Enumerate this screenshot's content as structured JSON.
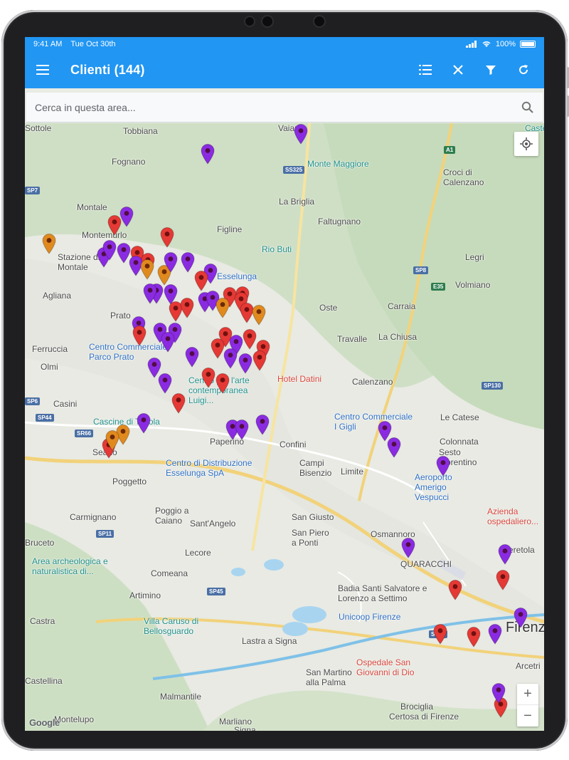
{
  "status": {
    "time": "9:41 AM",
    "date": "Tue Oct 30th",
    "battery": "100%"
  },
  "appbar": {
    "title": "Clienti (144)",
    "actions": [
      "list-icon",
      "close-icon",
      "filter-icon",
      "refresh-icon"
    ]
  },
  "search": {
    "placeholder": "Cerca in questa area..."
  },
  "colors": {
    "accent": "#2196f3",
    "pin_red": "#e53935",
    "pin_purple": "#8a2be2",
    "pin_orange": "#e08a1e"
  },
  "places": [
    {
      "t": "Tobbiana",
      "c": ""
    },
    {
      "t": "Fognano",
      "c": ""
    },
    {
      "t": "Montale",
      "c": ""
    },
    {
      "t": "Montemurlo",
      "c": ""
    },
    {
      "t": "Stazione di Montale",
      "c": ""
    },
    {
      "t": "Agliana",
      "c": ""
    },
    {
      "t": "Figline",
      "c": ""
    },
    {
      "t": "Faltugnano",
      "c": ""
    },
    {
      "t": "La Briglia",
      "c": ""
    },
    {
      "t": "Vaiano",
      "c": ""
    },
    {
      "t": "Monte Maggiore",
      "c": "poi-teal"
    },
    {
      "t": "Rio Buti",
      "c": "poi-teal"
    },
    {
      "t": "Croci di Calenzano",
      "c": ""
    },
    {
      "t": "Legri",
      "c": ""
    },
    {
      "t": "Volmiano",
      "c": ""
    },
    {
      "t": "Carraia",
      "c": ""
    },
    {
      "t": "La Chiusa",
      "c": ""
    },
    {
      "t": "Travalle",
      "c": ""
    },
    {
      "t": "Ferruccia",
      "c": ""
    },
    {
      "t": "Olmi",
      "c": ""
    },
    {
      "t": "Casini",
      "c": ""
    },
    {
      "t": "Centro Commerciale Parco Prato",
      "c": "poi-blue"
    },
    {
      "t": "Esselunga",
      "c": "poi-blue"
    },
    {
      "t": "Centro per l'arte contemporanea Luigi...",
      "c": "poi-teal"
    },
    {
      "t": "Hotel Datini",
      "c": "poi-red"
    },
    {
      "t": "Calenzano",
      "c": ""
    },
    {
      "t": "Le Catese",
      "c": ""
    },
    {
      "t": "Colonnata",
      "c": ""
    },
    {
      "t": "Cascine di Tavola",
      "c": "poi-teal"
    },
    {
      "t": "Paperino",
      "c": ""
    },
    {
      "t": "Confini",
      "c": ""
    },
    {
      "t": "Centro Commerciale I Gigli",
      "c": "poi-blue"
    },
    {
      "t": "Sesto Fiorentino",
      "c": ""
    },
    {
      "t": "Signa",
      "c": ""
    },
    {
      "t": "Poggetto",
      "c": ""
    },
    {
      "t": "Centro di Distribuzione Esselunga SpA",
      "c": "poi-blue"
    },
    {
      "t": "Campi Bisenzio",
      "c": ""
    },
    {
      "t": "Limite",
      "c": ""
    },
    {
      "t": "Aeroporto Amerigo Vespucci",
      "c": "poi-blue"
    },
    {
      "t": "Azienda ospedaliero...",
      "c": "poi-red"
    },
    {
      "t": "Carmignano",
      "c": ""
    },
    {
      "t": "Poggio a Caiano",
      "c": ""
    },
    {
      "t": "Sant'Angelo",
      "c": ""
    },
    {
      "t": "San Giusto",
      "c": ""
    },
    {
      "t": "San Piero a Ponti",
      "c": ""
    },
    {
      "t": "Osmannoro",
      "c": ""
    },
    {
      "t": "Seano",
      "c": ""
    },
    {
      "t": "Bruceto",
      "c": ""
    },
    {
      "t": "Area archeologica e naturalistica di...",
      "c": "poi-teal"
    },
    {
      "t": "Lecore",
      "c": ""
    },
    {
      "t": "Comeana",
      "c": ""
    },
    {
      "t": "Artimino",
      "c": ""
    },
    {
      "t": "Badia Santi Salvatore e Lorenzo a Settimo",
      "c": ""
    },
    {
      "t": "Unicoop Firenze",
      "c": "poi-blue"
    },
    {
      "t": "Villa Caruso di Bellosguardo",
      "c": "poi-teal"
    },
    {
      "t": "Castra",
      "c": ""
    },
    {
      "t": "Lastra a Signa",
      "c": ""
    },
    {
      "t": "Ospedale San Giovanni di Dio",
      "c": "poi-red"
    },
    {
      "t": "Firenze",
      "c": "big"
    },
    {
      "t": "San Martino alla Palma",
      "c": ""
    },
    {
      "t": "Malmantile",
      "c": ""
    },
    {
      "t": "Brociglia",
      "c": ""
    },
    {
      "t": "Certosa di Firenze",
      "c": ""
    },
    {
      "t": "Montelupo",
      "c": ""
    },
    {
      "t": "Marliano",
      "c": ""
    },
    {
      "t": "Arcetri",
      "c": ""
    },
    {
      "t": "Castello",
      "c": "poi-teal"
    },
    {
      "t": "Castellina",
      "c": ""
    },
    {
      "t": "Peretola",
      "c": ""
    },
    {
      "t": "QUARACCHI",
      "c": ""
    },
    {
      "t": "Prato",
      "c": ""
    },
    {
      "t": "Oste",
      "c": ""
    },
    {
      "t": "Sottole",
      "c": ""
    }
  ],
  "roads": [
    "SS325",
    "A1",
    "SP8",
    "E35",
    "SP130",
    "SP44",
    "SR66",
    "SP11",
    "SP45",
    "SS67",
    "SP7",
    "SP6"
  ],
  "pins": [
    {
      "c": "purple"
    },
    {
      "c": "purple"
    },
    {
      "c": "orange"
    },
    {
      "c": "red"
    },
    {
      "c": "purple"
    },
    {
      "c": "red"
    },
    {
      "c": "purple"
    },
    {
      "c": "purple"
    },
    {
      "c": "purple"
    },
    {
      "c": "red"
    },
    {
      "c": "purple"
    },
    {
      "c": "orange"
    },
    {
      "c": "red"
    },
    {
      "c": "purple"
    },
    {
      "c": "purple"
    },
    {
      "c": "purple"
    },
    {
      "c": "orange"
    },
    {
      "c": "purple"
    },
    {
      "c": "purple"
    },
    {
      "c": "purple"
    },
    {
      "c": "red"
    },
    {
      "c": "purple"
    },
    {
      "c": "red"
    },
    {
      "c": "red"
    },
    {
      "c": "purple"
    },
    {
      "c": "orange"
    },
    {
      "c": "red"
    },
    {
      "c": "red"
    },
    {
      "c": "orange"
    },
    {
      "c": "red"
    },
    {
      "c": "purple"
    },
    {
      "c": "red"
    },
    {
      "c": "purple"
    },
    {
      "c": "red"
    },
    {
      "c": "purple"
    },
    {
      "c": "red"
    },
    {
      "c": "red"
    },
    {
      "c": "purple"
    },
    {
      "c": "red"
    },
    {
      "c": "red"
    },
    {
      "c": "purple"
    },
    {
      "c": "purple"
    },
    {
      "c": "purple"
    },
    {
      "c": "red"
    },
    {
      "c": "red"
    },
    {
      "c": "purple"
    },
    {
      "c": "purple"
    },
    {
      "c": "red"
    },
    {
      "c": "purple"
    },
    {
      "c": "purple"
    },
    {
      "c": "orange"
    },
    {
      "c": "red"
    },
    {
      "c": "orange"
    },
    {
      "c": "red"
    },
    {
      "c": "purple"
    },
    {
      "c": "purple"
    },
    {
      "c": "purple"
    },
    {
      "c": "purple"
    },
    {
      "c": "purple"
    },
    {
      "c": "purple"
    },
    {
      "c": "purple"
    },
    {
      "c": "purple"
    },
    {
      "c": "red"
    },
    {
      "c": "red"
    },
    {
      "c": "purple"
    },
    {
      "c": "purple"
    },
    {
      "c": "red"
    },
    {
      "c": "red"
    },
    {
      "c": "red"
    },
    {
      "c": "purple"
    }
  ],
  "map": {
    "zoom_in": "+",
    "zoom_out": "−",
    "attribution": "Google"
  }
}
